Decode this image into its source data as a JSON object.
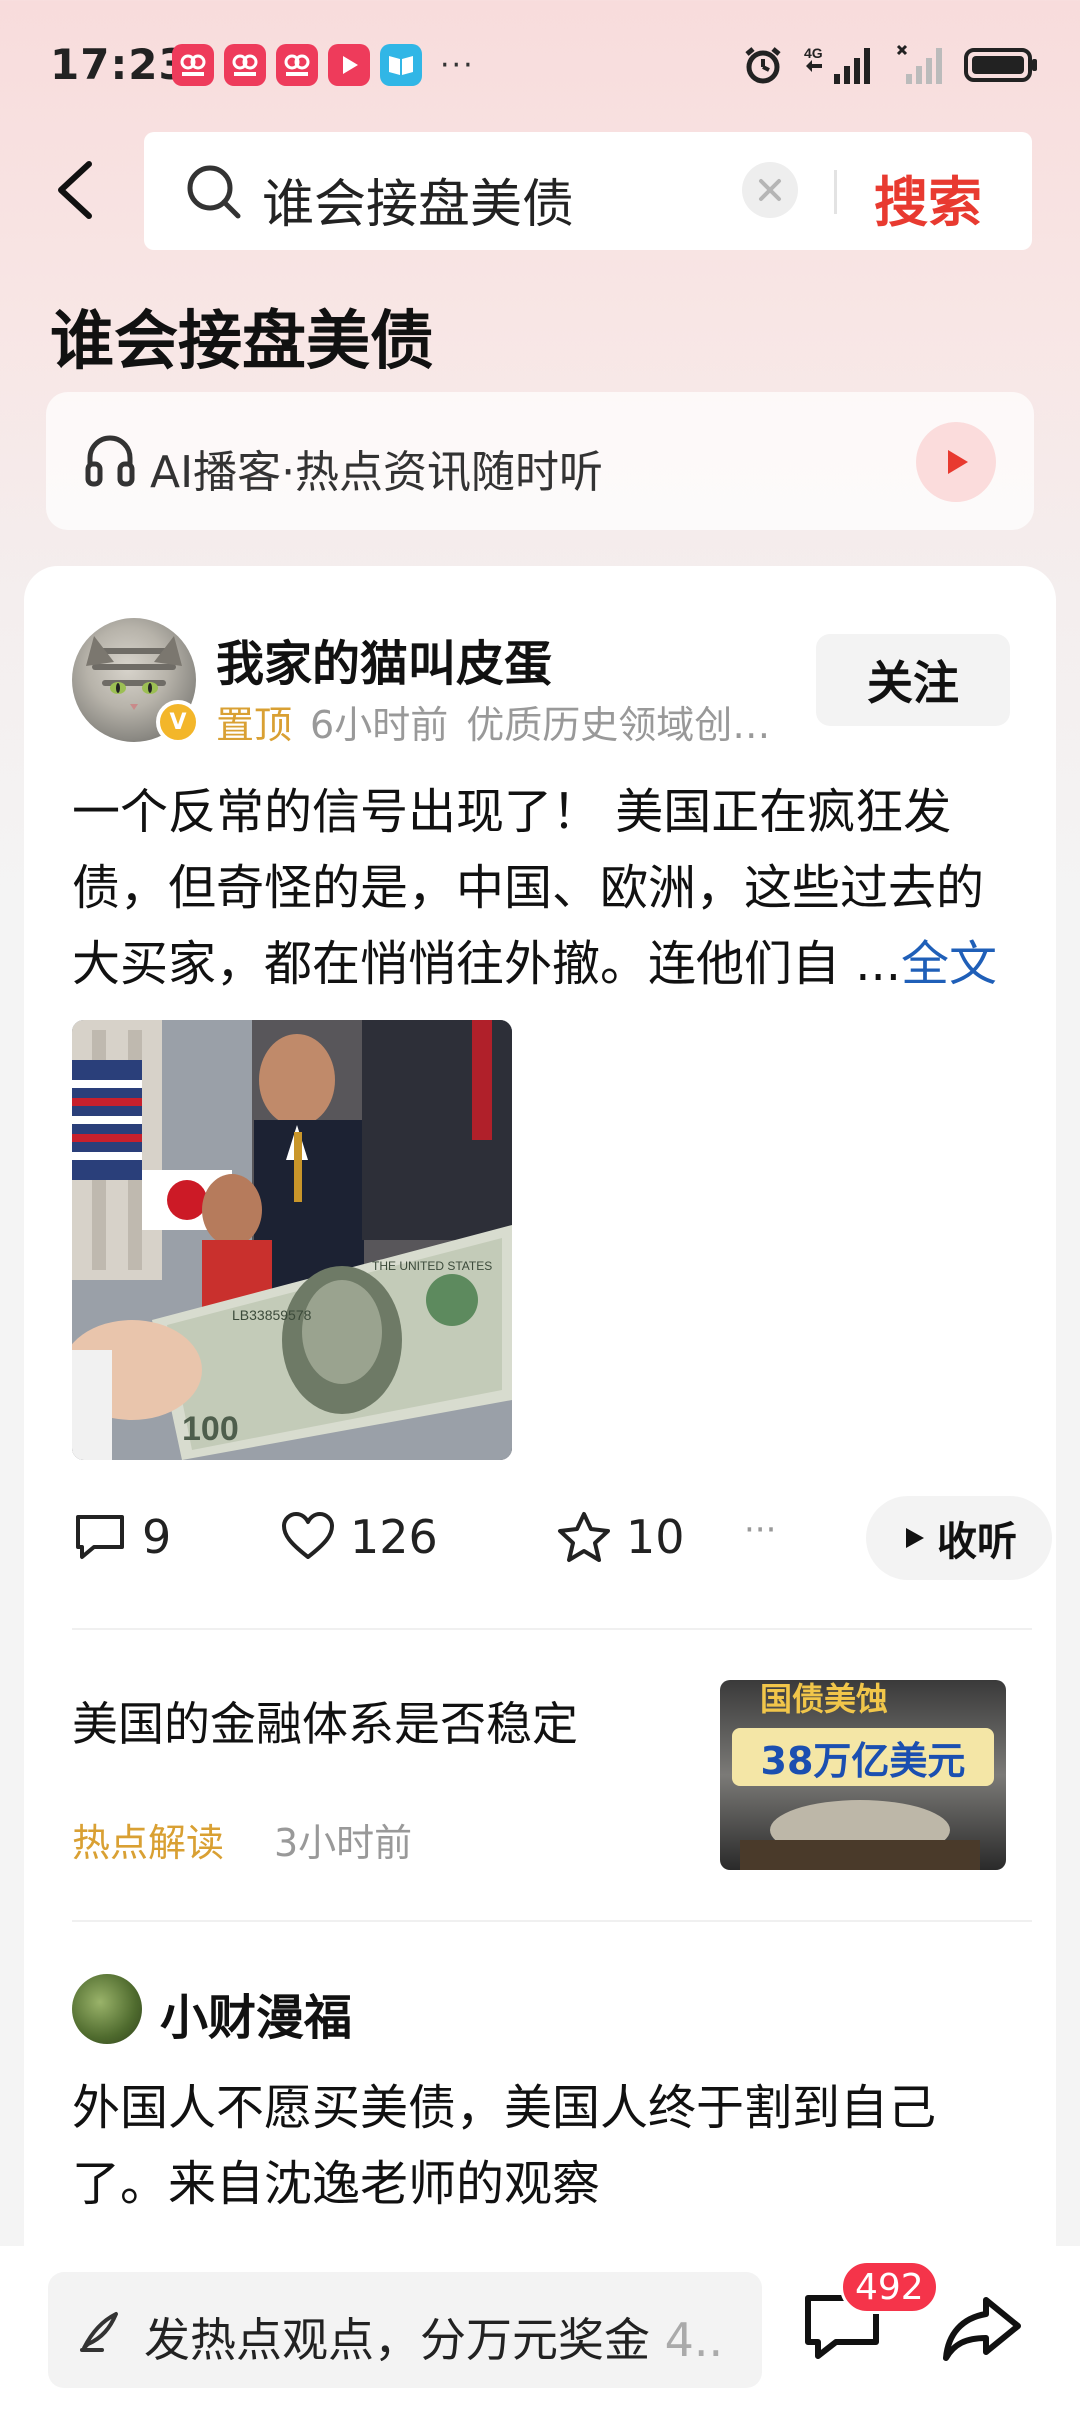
{
  "status_bar": {
    "time": "17:23",
    "notifications": [
      {
        "icon": "app-notification-icon",
        "color": "#ee3b5b"
      },
      {
        "icon": "app-notification-icon",
        "color": "#ee3b5b"
      },
      {
        "icon": "app-notification-icon",
        "color": "#ee3b5b"
      },
      {
        "icon": "video-play-icon",
        "color": "#ee3b5b"
      },
      {
        "icon": "book-icon",
        "color": "#31b6e6"
      }
    ],
    "more": "···",
    "network": "4G"
  },
  "search": {
    "query": "谁会接盘美债",
    "submit_label": "搜索"
  },
  "page_title": "谁会接盘美债",
  "podcast": {
    "label": "AI播客·热点资讯随时听"
  },
  "post": {
    "author": "我家的猫叫皮蛋",
    "verified_mark": "V",
    "pinned": "置顶",
    "time": "6小时前",
    "tag": "优质历史领域创…",
    "follow_label": "关注",
    "text_lines": [
      "一个反常的信号出现了！ 美国正在疯狂发",
      "债，但奇怪的是，中国、欧洲，这些过去的",
      "大买家，都在悄悄往外撤。连他们自 ..."
    ],
    "full_text_link": "全文",
    "image_alt_text": {
      "bill_serial": "LB33859578",
      "bill_text_top": "THE UNITED STATES",
      "bill_value": "100"
    },
    "comments": "9",
    "likes": "126",
    "favorites": "10",
    "more": "···",
    "listen_label": "收听"
  },
  "related": {
    "title": "美国的金融体系是否稳定",
    "tag": "热点解读",
    "time": "3小时前",
    "thumb_top": "国债美蚀",
    "thumb_mid": "38万亿美元"
  },
  "post2": {
    "author": "小财漫福",
    "text_lines": [
      "外国人不愿买美债，美国人终于割到自己",
      "了。来自沈逸老师的观察"
    ]
  },
  "bottom_bar": {
    "input_placeholder": "发热点观点，分万元奖金",
    "input_suffix": " 4..",
    "comment_count": "492"
  },
  "colors": {
    "accent_red": "#e83a30",
    "link_blue": "#1f5fb8",
    "gold": "#d9a033",
    "badge_red": "#f5344a"
  }
}
